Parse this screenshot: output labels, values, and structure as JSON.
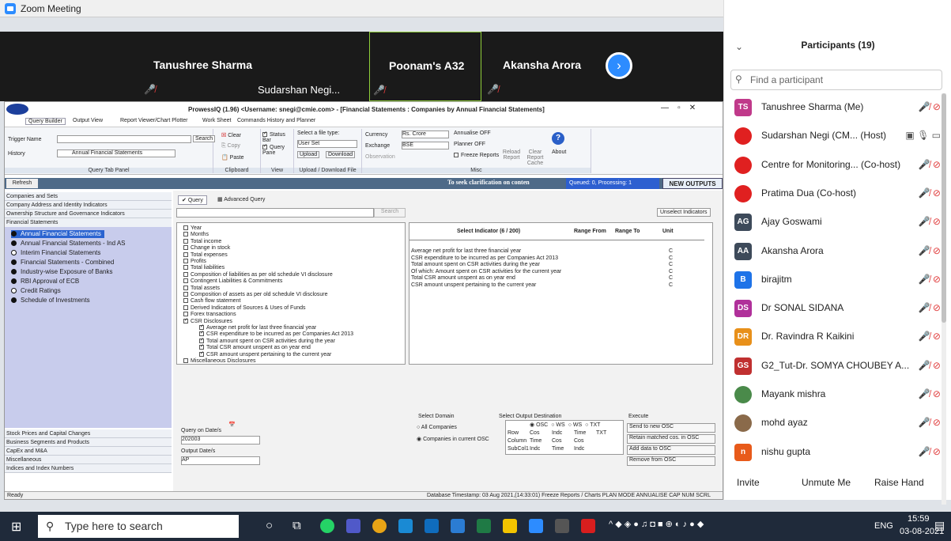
{
  "window": {
    "title": "Zoom Meeting",
    "min": "—",
    "max": "☐",
    "close": "✕"
  },
  "video": {
    "tiles": [
      {
        "name": "Tanushree Sharma"
      },
      {
        "name": "Sudarshan Negi..."
      },
      {
        "name": "Poonam's A32"
      },
      {
        "name": "Akansha Arora"
      }
    ]
  },
  "app": {
    "title": "ProwessIQ (1.96) <Username: snegi@cmie.com> - [Financial Statements : Companies by Annual Financial Statements]",
    "tabs": [
      "Query Builder",
      "Output View",
      "Report Viewer/Chart Plotter",
      "Work Sheet",
      "Commands History and Planner"
    ],
    "ribbon": {
      "trigger_label": "Trigger Name",
      "search_btn": "Search",
      "history_label": "History",
      "history_value": "Annual Financial Statements",
      "query_tab_panel": "Query Tab Panel",
      "clear": "Clear",
      "copy": "Copy",
      "paste": "Paste",
      "clipboard": "Clipboard",
      "status_bar": "Status Bar",
      "query_pane": "Query Pane",
      "view": "View",
      "select_file": "Select a file type:",
      "user_set": "User Set",
      "upload": "Upload",
      "download": "Download",
      "upload_download": "Upload / Download File",
      "currency": "Currency",
      "currency_val": "Rs. Crore",
      "exchange": "Exchange",
      "exchange_val": "BSE",
      "observation": "Observation",
      "annualise": "Annualise OFF",
      "planner": "Planner OFF",
      "freeze": "Freeze Reports",
      "reload": "Reload Report",
      "clear_cache": "Clear Report Cache",
      "about": "About",
      "misc": "Misc"
    },
    "refresh": "Refresh",
    "clarification": "To seek clarification on conten",
    "queued": "Queued: 0, Processing: 1",
    "new_outputs": "NEW OUTPUTS",
    "left_headers": [
      "Companies and Sets",
      "Company Address and Identity Indicators",
      "Ownership Structure and Governance Indicators",
      "Financial Statements"
    ],
    "left_items": [
      {
        "label": "Annual Financial Statements",
        "selected": true,
        "hollow": false
      },
      {
        "label": "Annual Financial Statements - Ind AS",
        "selected": false,
        "hollow": false
      },
      {
        "label": "Interim Financial Statements",
        "selected": false,
        "hollow": true
      },
      {
        "label": "Financial Statements - Combined",
        "selected": false,
        "hollow": false
      },
      {
        "label": "Industry-wise Exposure of Banks",
        "selected": false,
        "hollow": false
      },
      {
        "label": "RBI Approval of ECB",
        "selected": false,
        "hollow": false
      },
      {
        "label": "Credit Ratings",
        "selected": false,
        "hollow": true
      },
      {
        "label": "Schedule of Investments",
        "selected": false,
        "hollow": false
      }
    ],
    "left_footer": [
      "Stock Prices and Capital Changes",
      "Business Segments and Products",
      "CapEx and M&A",
      "Miscellaneous",
      "Indices and Index Numbers"
    ],
    "query_tabs": [
      "Query",
      "Advanced Query"
    ],
    "search_btn2": "Search",
    "unselect": "Unselect Indicators",
    "tree": [
      {
        "t": "Year",
        "c": false,
        "i": 0
      },
      {
        "t": "Months",
        "c": false,
        "i": 0
      },
      {
        "t": "Total income",
        "c": false,
        "i": 0
      },
      {
        "t": "Change in stock",
        "c": false,
        "i": 0
      },
      {
        "t": "Total expenses",
        "c": false,
        "i": 0
      },
      {
        "t": "Profits",
        "c": false,
        "i": 0
      },
      {
        "t": "Total liabilities",
        "c": false,
        "i": 0
      },
      {
        "t": "Composition of liabilities as per old schedule VI disclosure",
        "c": false,
        "i": 0
      },
      {
        "t": "Contingent Liabilities & Commitments",
        "c": false,
        "i": 0
      },
      {
        "t": "Total assets",
        "c": false,
        "i": 0
      },
      {
        "t": "Composition of assets as per old schedule VI disclosure",
        "c": false,
        "i": 0
      },
      {
        "t": "Cash flow statement",
        "c": false,
        "i": 0
      },
      {
        "t": "Derived Indicators of Sources & Uses of Funds",
        "c": false,
        "i": 0
      },
      {
        "t": "Forex transactions",
        "c": false,
        "i": 0
      },
      {
        "t": "CSR Disclosures",
        "c": true,
        "i": 0
      },
      {
        "t": "Average net profit for last three financial year",
        "c": true,
        "i": 1
      },
      {
        "t": "CSR expenditure to be incurred as per Companies Act 2013",
        "c": true,
        "i": 1
      },
      {
        "t": "Total amount spent on CSR activities during the year",
        "c": true,
        "i": 1
      },
      {
        "t": "Total CSR amount unspent as on year end",
        "c": true,
        "i": 1
      },
      {
        "t": "CSR amount unspent pertaining to the current year",
        "c": true,
        "i": 1
      },
      {
        "t": "Miscellaneous Disclosures",
        "c": false,
        "i": 0
      }
    ],
    "ind_headers": [
      "Select Indicator (6 / 200)",
      "Range From",
      "Range To",
      "Unit"
    ],
    "ind_rows": [
      {
        "name": "Average net profit for last three financial year",
        "unit": "C"
      },
      {
        "name": "CSR expenditure to be incurred as per Companies Act 2013",
        "unit": "C"
      },
      {
        "name": "Total amount spent on CSR activities during the year",
        "unit": "C"
      },
      {
        "name": "Of which: Amount spent on CSR activities for the current year",
        "unit": "C"
      },
      {
        "name": "Total CSR amount unspent as on year end",
        "unit": "C"
      },
      {
        "name": "CSR amount unspent pertaining to the current year",
        "unit": "C"
      }
    ],
    "query_on_date": "Query on Date/s",
    "date_val": "202003",
    "output_date": "Output Date/s",
    "output_val": "AP",
    "select_domain": "Select Domain",
    "all_companies": "All Companies",
    "companies_osc": "Companies in current OSC",
    "select_output": "Select Output Destination",
    "execute": "Execute",
    "dest_head": [
      "OSC",
      "WS",
      "WS",
      "TXT"
    ],
    "dest_rows": [
      [
        "Row",
        "Cos",
        "Indc",
        "Time",
        "TXT"
      ],
      [
        "Column",
        "Time",
        "Cos",
        "Cos",
        ""
      ],
      [
        "SubCol1",
        "Indc",
        "Time",
        "Indc",
        ""
      ]
    ],
    "exec_btns": [
      "Send to new OSC",
      "Retain matched cos. in OSC",
      "Add data to OSC",
      "Remove from OSC"
    ],
    "status_ready": "Ready",
    "status_right": "Database Timestamp: 03 Aug 2021,(14:33:01)  Freeze Reports / Charts  PLAN MODE  ANNUALISE  CAP  NUM  SCRL"
  },
  "participants": {
    "title": "Participants (19)",
    "search_placeholder": "Find a participant",
    "list": [
      {
        "name": "Tanushree Sharma (Me)",
        "initials": "TS",
        "color": "#c0398a"
      },
      {
        "name": "Sudarshan Negi (CM... (Host)",
        "initials": "",
        "color": "#e02020"
      },
      {
        "name": "Centre for Monitoring... (Co-host)",
        "initials": "",
        "color": "#e02020"
      },
      {
        "name": "Pratima Dua (Co-host)",
        "initials": "",
        "color": "#e02020"
      },
      {
        "name": "Ajay Goswami",
        "initials": "AG",
        "color": "#3d4a5a"
      },
      {
        "name": "Akansha Arora",
        "initials": "AA",
        "color": "#3d4a5a"
      },
      {
        "name": "birajitm",
        "initials": "B",
        "color": "#1e73e8"
      },
      {
        "name": "Dr SONAL SIDANA",
        "initials": "DS",
        "color": "#b0309a"
      },
      {
        "name": "Dr. Ravindra R Kaikini",
        "initials": "DR",
        "color": "#e8901a"
      },
      {
        "name": "G2_Tut-Dr. SOMYA CHOUBEY A...",
        "initials": "GS",
        "color": "#c03030"
      },
      {
        "name": "Mayank mishra",
        "initials": "",
        "color": "#4a8a4a"
      },
      {
        "name": "mohd ayaz",
        "initials": "",
        "color": "#8a6a4a"
      },
      {
        "name": "nishu gupta",
        "initials": "n",
        "color": "#e85a1a"
      }
    ],
    "invite": "Invite",
    "unmute": "Unmute Me",
    "raise": "Raise Hand"
  },
  "taskbar": {
    "search": "Type here to search",
    "lang": "ENG",
    "time": "15:59",
    "date": "03-08-2021"
  }
}
